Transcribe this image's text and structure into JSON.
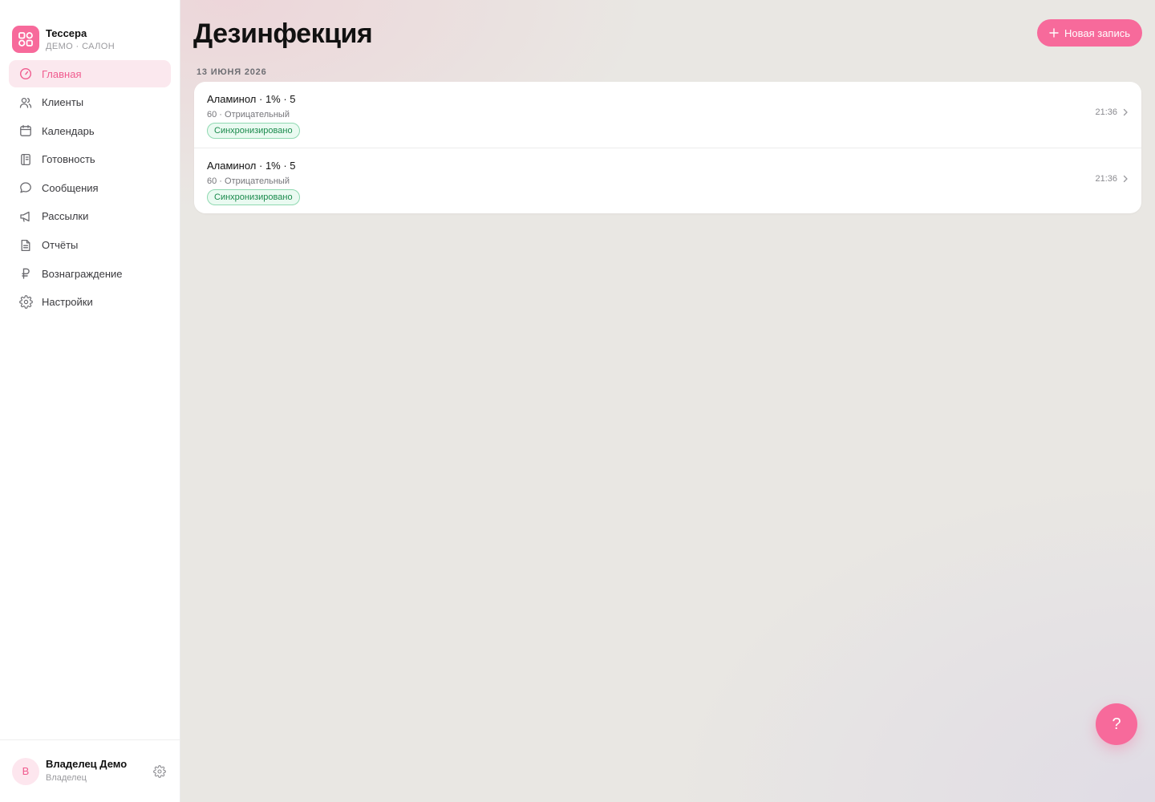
{
  "brand": {
    "name": "Тессера",
    "subtitle": "ДЕМО · САЛОН"
  },
  "nav": [
    {
      "label": "Главная",
      "icon": "gauge-icon",
      "active": true
    },
    {
      "label": "Клиенты",
      "icon": "users-icon"
    },
    {
      "label": "Календарь",
      "icon": "calendar-icon"
    },
    {
      "label": "Готовность",
      "icon": "notebook-icon"
    },
    {
      "label": "Сообщения",
      "icon": "chat-bubble-icon"
    },
    {
      "label": "Рассылки",
      "icon": "megaphone-icon"
    },
    {
      "label": "Отчёты",
      "icon": "document-icon"
    },
    {
      "label": "Вознаграждение",
      "icon": "ruble-icon"
    },
    {
      "label": "Настройки",
      "icon": "gear-icon"
    }
  ],
  "user": {
    "initial": "В",
    "name": "Владелец Демо",
    "role": "Владелец"
  },
  "page": {
    "title": "Дезинфекция",
    "new_button": "Новая запись",
    "date_group": "13 ИЮНЯ 2026"
  },
  "records": [
    {
      "title": "Аламинол · 1% · 5",
      "subtitle": "60 · Отрицательный",
      "status": "Синхронизировано",
      "time": "21:36"
    },
    {
      "title": "Аламинол · 1% · 5",
      "subtitle": "60 · Отрицательный",
      "status": "Синхронизировано",
      "time": "21:36"
    }
  ],
  "help": {
    "label": "?"
  },
  "colors": {
    "accent": "#f76a9b",
    "success": "#1a8a4c"
  }
}
